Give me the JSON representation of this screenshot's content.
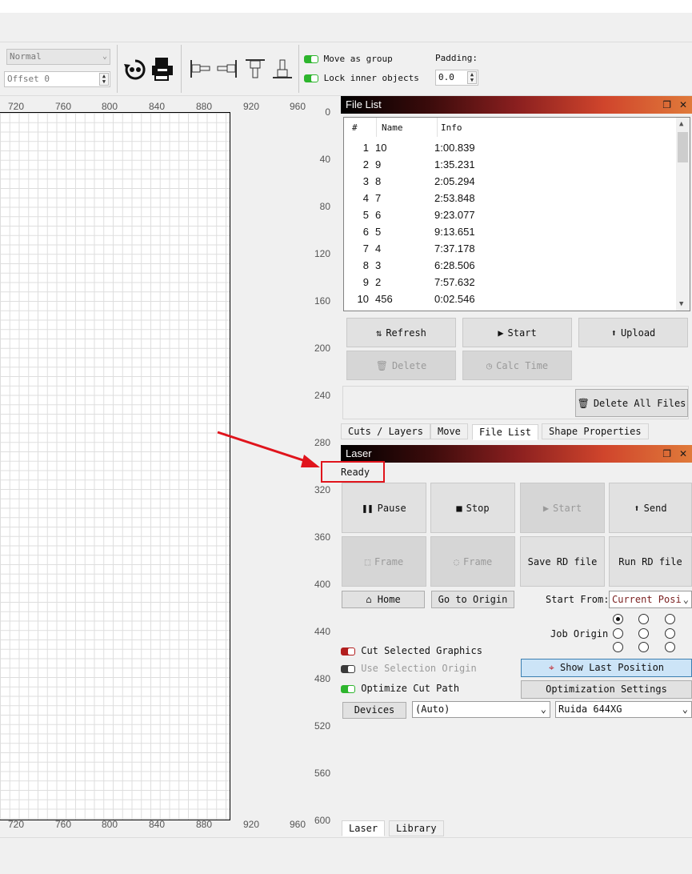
{
  "toolbar": {
    "mode_value": "Normal",
    "offset_value": "Offset 0",
    "move_as_group_label": "Move as group",
    "lock_inner_objects_label": "Lock inner objects",
    "padding_label": "Padding:",
    "padding_value": "0.0"
  },
  "ruler": {
    "top_ticks": [
      "720",
      "760",
      "800",
      "840",
      "880",
      "920",
      "960"
    ],
    "left_ticks": [
      "0",
      "40",
      "80",
      "120",
      "160",
      "200",
      "240",
      "280",
      "320",
      "360",
      "400",
      "440",
      "480",
      "520",
      "560",
      "600"
    ]
  },
  "file_list_panel": {
    "title": "File List",
    "columns": [
      "#",
      "Name",
      "Info"
    ],
    "rows": [
      {
        "num": "1",
        "name": "10",
        "info": "1:00.839"
      },
      {
        "num": "2",
        "name": "9",
        "info": "1:35.231"
      },
      {
        "num": "3",
        "name": "8",
        "info": "2:05.294"
      },
      {
        "num": "4",
        "name": "7",
        "info": "2:53.848"
      },
      {
        "num": "5",
        "name": "6",
        "info": "9:23.077"
      },
      {
        "num": "6",
        "name": "5",
        "info": "9:13.651"
      },
      {
        "num": "7",
        "name": "4",
        "info": "7:37.178"
      },
      {
        "num": "8",
        "name": "3",
        "info": "6:28.506"
      },
      {
        "num": "9",
        "name": "2",
        "info": "7:57.632"
      },
      {
        "num": "10",
        "name": "456",
        "info": "0:02.546"
      }
    ],
    "buttons": {
      "refresh": "Refresh",
      "start": "Start",
      "upload": "Upload",
      "delete": "Delete",
      "calc_time": "Calc Time",
      "delete_all": "Delete All Files"
    },
    "tabs": [
      "Cuts / Layers",
      "Move",
      "File List",
      "Shape Properties"
    ]
  },
  "laser_panel": {
    "title": "Laser",
    "status": "Ready",
    "buttons": {
      "pause": "Pause",
      "stop": "Stop",
      "start": "Start",
      "send": "Send",
      "frame1": "Frame",
      "frame2": "Frame",
      "save_rd": "Save RD file",
      "run_rd": "Run RD file",
      "home": "Home",
      "go_to_origin": "Go to Origin",
      "show_last_position": "Show Last Position",
      "optimization_settings": "Optimization Settings",
      "devices": "Devices"
    },
    "start_from_label": "Start From:",
    "start_from_value": "Current Posi",
    "job_origin_label": "Job Origin",
    "cut_selected_graphics": "Cut Selected Graphics",
    "use_selection_origin": "Use Selection Origin",
    "optimize_cut_path": "Optimize Cut Path",
    "port_value": "(Auto)",
    "device_value": "Ruida 644XG"
  },
  "bottom_tabs": [
    "Laser",
    "Library"
  ],
  "colors": {
    "annotation": "#e0141c",
    "toggle_on": "#2db52d",
    "toggle_cut": "#b21e1e",
    "selected_button": "#cce4f7"
  }
}
